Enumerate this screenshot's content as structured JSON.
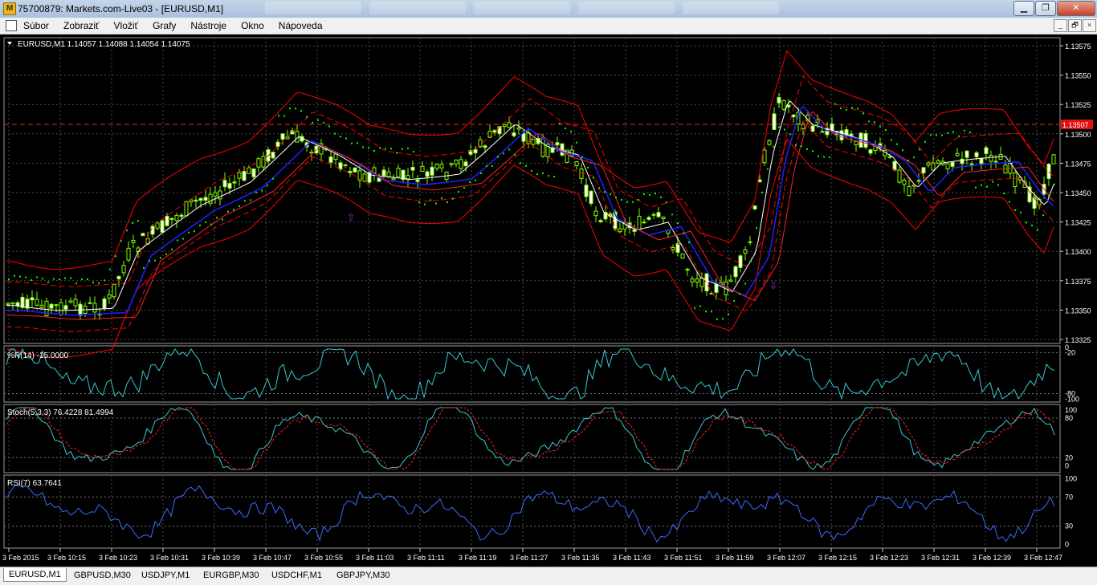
{
  "window": {
    "title": "75700879: Markets.com-Live03 - [EURUSD,M1]",
    "app_icon_letter": "M",
    "buttons": {
      "minimize": "▁",
      "maximize": "❐",
      "close": "✕"
    }
  },
  "menu": {
    "items": [
      "Súbor",
      "Zobraziť",
      "Vložiť",
      "Grafy",
      "Nástroje",
      "Okno",
      "Nápoveda"
    ],
    "mdi_buttons": [
      "_",
      "🗗",
      "×"
    ]
  },
  "chart": {
    "header": "EURUSD,M1  1.14057 1.14088 1.14054 1.14075",
    "price_axis": [
      "1.13575",
      "1.13550",
      "1.13525",
      "1.13500",
      "1.13475",
      "1.13450",
      "1.13425",
      "1.13400",
      "1.13375",
      "1.13350",
      "1.13325"
    ],
    "current_price": "1.13507",
    "colors": {
      "background": "#000000",
      "grid": "#4a4a4a",
      "candles": "#7fff00",
      "bollinger": "#ff0000",
      "ma_white": "#ffffff",
      "ma_blue": "#2020ff",
      "ma_red": "#ff2020",
      "sar": "#00ff00",
      "wpr": "#36c8d0",
      "stoch_main": "#36c8d0",
      "stoch_signal": "#ff2020",
      "rsi": "#3a6cff",
      "arrow": "#9030c0"
    },
    "time_axis": [
      "3 Feb 2015",
      "3 Feb 10:15",
      "3 Feb 10:23",
      "3 Feb 10:31",
      "3 Feb 10:39",
      "3 Feb 10:47",
      "3 Feb 10:55",
      "3 Feb 11:03",
      "3 Feb 11:11",
      "3 Feb 11:19",
      "3 Feb 11:27",
      "3 Feb 11:35",
      "3 Feb 11:43",
      "3 Feb 11:51",
      "3 Feb 11:59",
      "3 Feb 12:07",
      "3 Feb 12:15",
      "3 Feb 12:23",
      "3 Feb 12:31",
      "3 Feb 12:39",
      "3 Feb 12:47"
    ]
  },
  "indicators": {
    "wpr": {
      "label": "%R(14) -15.0000",
      "levels": [
        "0",
        "-20",
        "-80",
        "-100"
      ]
    },
    "stoch": {
      "label": "Stoch(5,3,3) 76.4228 81.4994",
      "levels": [
        "100",
        "80",
        "20",
        "0"
      ]
    },
    "rsi": {
      "label": "RSI(7) 63.7641",
      "levels": [
        "100",
        "70",
        "30",
        "0"
      ]
    }
  },
  "tabs": [
    "EURUSD,M1",
    "GBPUSD,M30",
    "USDJPY,M1",
    "EURGBP,M30",
    "USDCHF,M1",
    "GBPJPY,M30"
  ]
}
